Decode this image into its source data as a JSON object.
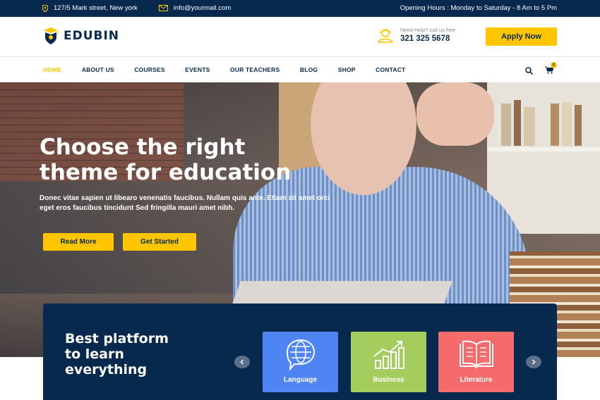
{
  "topbar": {
    "address": "127/5 Mark street, New york",
    "email": "info@yourmail.com",
    "hours": "Opening Hours : Monday to Saturday - 8 Am to 5 Pm"
  },
  "header": {
    "logo_text": "EDUBIN",
    "help_label": "Need Help? call us free",
    "phone": "321 325 5678",
    "apply_label": "Apply Now"
  },
  "nav": {
    "items": [
      "HOME",
      "ABOUT US",
      "COURSES",
      "EVENTS",
      "OUR TEACHERS",
      "BLOG",
      "SHOP",
      "CONTACT"
    ],
    "active": "HOME",
    "cart_count": "0"
  },
  "hero": {
    "title_line1": "Choose the right",
    "title_line2": "theme for education",
    "subtitle": "Donec vitae sapien ut libearo venenatis faucibus. Nullam quis ante. Etiam sit amet orci eget eros faucibus tincidunt Sed fringilla mauri amet nibh.",
    "read_more": "Read More",
    "get_started": "Get Started"
  },
  "categories": {
    "title_line1": "Best platform",
    "title_line2": "to learn",
    "title_line3": "everything",
    "items": [
      {
        "label": "Language",
        "icon": "globe-icon",
        "color": "#4f85f2"
      },
      {
        "label": "Business",
        "icon": "chart-icon",
        "color": "#a4cd5d"
      },
      {
        "label": "Literature",
        "icon": "book-icon",
        "color": "#f56b6b"
      }
    ]
  },
  "colors": {
    "navy": "#07294d",
    "accent": "#ffc600"
  }
}
